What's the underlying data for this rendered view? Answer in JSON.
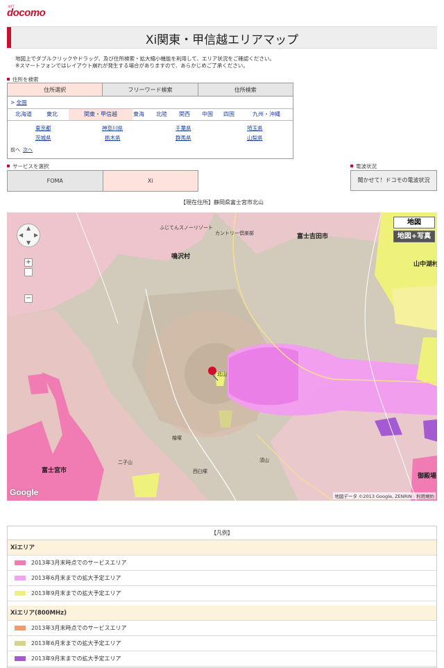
{
  "header": {
    "brand_small": "NTT",
    "brand": "docomo",
    "title": "Xi関東・甲信越エリアマップ"
  },
  "notes": [
    "地図上でダブルクリックやドラッグ、及び住所検索・拡大縮小機能を利用して、エリア状況をご確認ください。",
    "※スマートフォンではレイアウト崩れが発生する場合がありますので、あらかじめご了承ください。"
  ],
  "address_search": {
    "label": "住所を検索",
    "tabs": [
      "住所選択",
      "フリーワード検索",
      "住所検索"
    ],
    "nationwide": "全国",
    "regions": [
      "北海道",
      "東北",
      "関東・甲信越",
      "東海",
      "北陸",
      "関西",
      "中国",
      "四国",
      "九州・沖縄"
    ],
    "prefectures": [
      "東京都",
      "神奈川県",
      "千葉県",
      "埼玉県",
      "茨城県",
      "栃木県",
      "群馬県",
      "山梨県"
    ],
    "prev": "前へ",
    "next": "次へ"
  },
  "service": {
    "label": "サービスを選択",
    "options": [
      "FOMA",
      "Xi"
    ]
  },
  "radio": {
    "label": "電波状況",
    "button": "聞かせて！ドコモの電波状況"
  },
  "current_address": "【現在住所】静岡県富士宮市北山",
  "map": {
    "btn_map": "地図",
    "btn_map_photo": "地図+写真",
    "zoom_in": "+",
    "zoom_out": "−",
    "google": "Google",
    "attribution": "地図データ ©2013 Google, ZENRIN · 利用規約",
    "labels": {
      "fujiyoshida": "富士吉田市",
      "narusawa": "鳴沢村",
      "fujinomiya": "富士宮市",
      "yamanakako": "山中湖村",
      "gotemba": "御殿場",
      "fujigolf": "ふじてんスノーリゾート",
      "country": "カントリー倶楽部",
      "kitayama": "北山",
      "ninotsuka": "二子山",
      "nishiusu": "西臼塚",
      "hinokizuka": "檜塚",
      "suganuma": "須山"
    }
  },
  "legend": {
    "title": "【凡例】",
    "sections": [
      {
        "name": "Xiエリア",
        "items": [
          {
            "label": "2013年3月末時点でのサービスエリア",
            "color": "#f07cb3"
          },
          {
            "label": "2013年6月末までの拡大予定エリア",
            "color": "#f3a3f3"
          },
          {
            "label": "2013年9月末までの拡大予定エリア",
            "color": "#eef27a"
          }
        ]
      },
      {
        "name": "Xiエリア(800MHz)",
        "items": [
          {
            "label": "2013年3月末時点でのサービスエリア",
            "color": "#f19a72"
          },
          {
            "label": "2013年6月末までの拡大予定エリア",
            "color": "#d6d48a"
          },
          {
            "label": "2013年9月末までの拡大予定エリア",
            "color": "#a35ad2"
          }
        ]
      }
    ]
  }
}
